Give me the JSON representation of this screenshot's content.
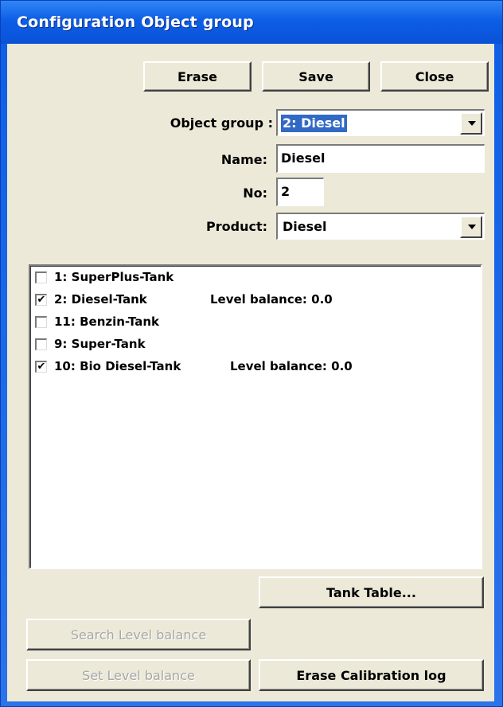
{
  "window": {
    "title": "Configuration Object group"
  },
  "toolbar": {
    "erase_label": "Erase",
    "save_label": "Save",
    "close_label": "Close"
  },
  "form": {
    "object_group_label": "Object group :",
    "object_group_value": "2: Diesel",
    "name_label": "Name:",
    "name_value": "Diesel",
    "no_label": "No:",
    "no_value": "2",
    "product_label": "Product:",
    "product_value": "Diesel"
  },
  "tanks": [
    {
      "label": "1: SuperPlus-Tank",
      "checked": false,
      "extra": ""
    },
    {
      "label": "2: Diesel-Tank",
      "checked": true,
      "extra": "Level balance: 0.0"
    },
    {
      "label": "11: Benzin-Tank",
      "checked": false,
      "extra": ""
    },
    {
      "label": "9: Super-Tank",
      "checked": false,
      "extra": ""
    },
    {
      "label": "10: Bio Diesel-Tank",
      "checked": true,
      "extra": "Level balance: 0.0"
    }
  ],
  "buttons": {
    "tank_table_label": "Tank Table...",
    "search_level_balance_label": "Search Level balance",
    "set_level_balance_label": "Set Level balance",
    "erase_calibration_log_label": "Erase Calibration log"
  },
  "icons": {
    "combo_arrow": "chevron-down-icon",
    "check": "✔"
  }
}
